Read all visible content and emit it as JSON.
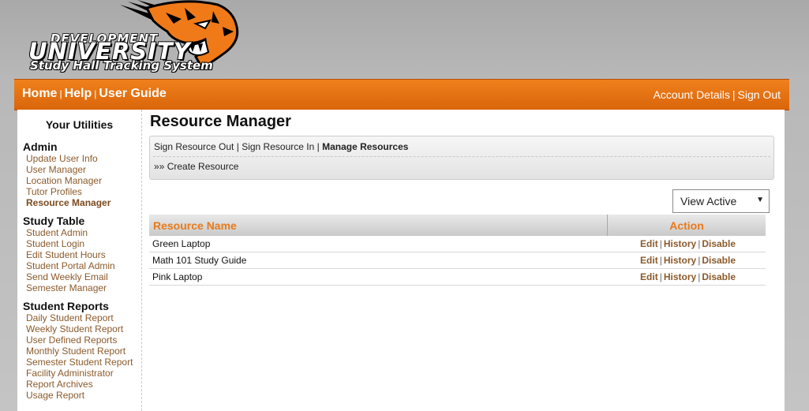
{
  "logo": {
    "line1": "DEVELOPMENT",
    "line2": "UNIVERSITY",
    "line3": "Study Hall Tracking System"
  },
  "nav": {
    "left": [
      {
        "name": "nav-home",
        "label": "Home"
      },
      {
        "name": "nav-help",
        "label": "Help"
      },
      {
        "name": "nav-user-guide",
        "label": "User Guide"
      }
    ],
    "right": [
      {
        "name": "nav-account-details",
        "label": "Account Details"
      },
      {
        "name": "nav-sign-out",
        "label": "Sign Out"
      }
    ],
    "separator": "|"
  },
  "sidebar": {
    "heading": "Your Utilities",
    "sections": [
      {
        "title": "Admin",
        "items": [
          "Update User Info",
          "User Manager",
          "Location Manager",
          "Tutor Profiles",
          "Resource Manager"
        ]
      },
      {
        "title": "Study Table",
        "items": [
          "Student Admin",
          "Student Login",
          "Edit Student Hours",
          "Student Portal Admin",
          "Send Weekly Email",
          "Semester Manager"
        ]
      },
      {
        "title": "Student Reports",
        "items": [
          "Daily Student Report",
          "Weekly Student Report",
          "User Defined Reports",
          "Monthly Student Report",
          "Semester Student Report",
          "Facility Administrator",
          "Report Archives",
          "Usage Report"
        ]
      }
    ],
    "active_item": "Resource Manager"
  },
  "main": {
    "title": "Resource Manager",
    "subnav": {
      "sign_out": "Sign Resource Out",
      "sign_in": "Sign Resource In",
      "manage": "Manage Resources",
      "separator": "|",
      "create_prefix": "»»",
      "create": "Create Resource"
    },
    "filter": {
      "selected": "View Active",
      "caret": "▼"
    },
    "table": {
      "columns": [
        "Resource Name",
        "Action"
      ],
      "rows": [
        {
          "name": "Green Laptop",
          "actions": [
            "Edit",
            "History",
            "Disable"
          ]
        },
        {
          "name": "Math 101 Study Guide",
          "actions": [
            "Edit",
            "History",
            "Disable"
          ]
        },
        {
          "name": "Pink Laptop",
          "actions": [
            "Edit",
            "History",
            "Disable"
          ]
        }
      ]
    }
  },
  "colors": {
    "accent_orange": "#e87a1a",
    "navbar_orange": "#e5700f",
    "link_brown": "#8b5a2b"
  }
}
